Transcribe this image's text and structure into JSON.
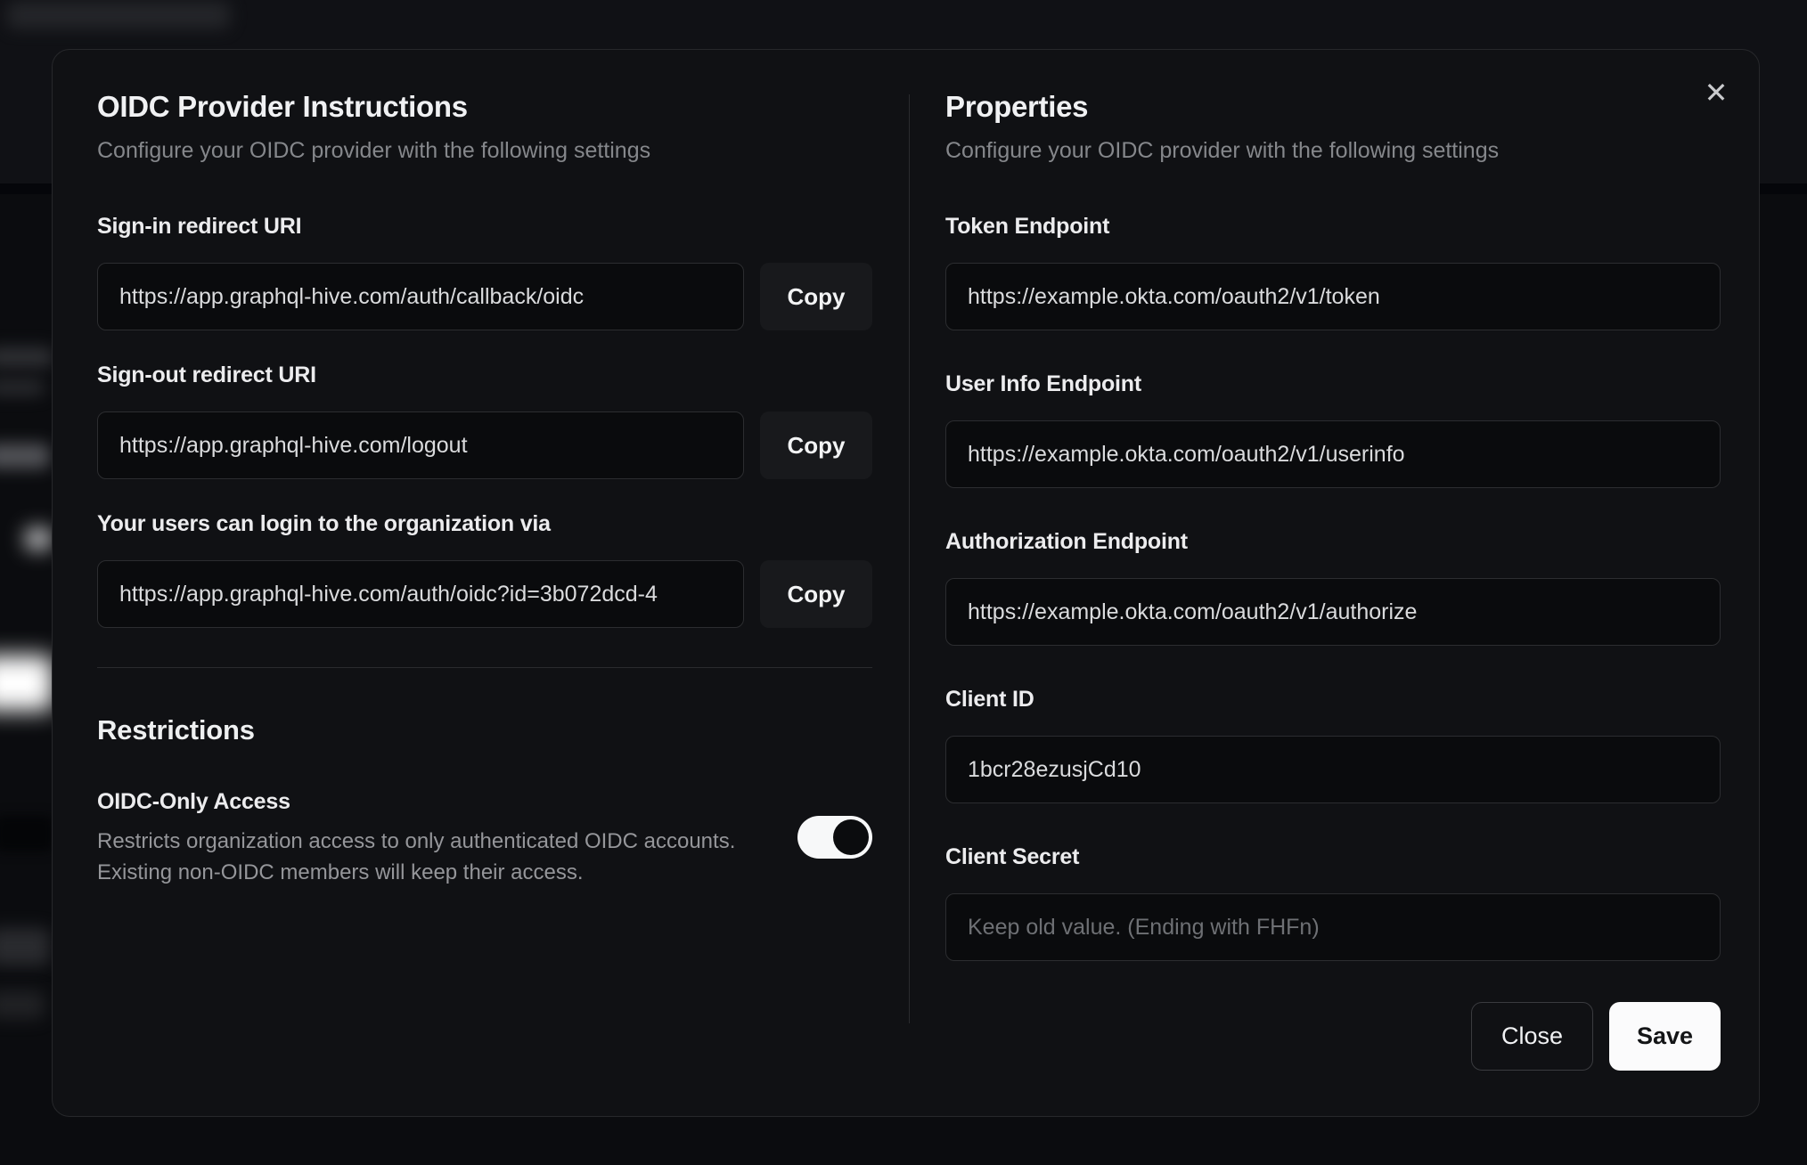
{
  "modal": {
    "close_glyph": "✕",
    "left": {
      "title": "OIDC Provider Instructions",
      "subtitle": "Configure your OIDC provider with the following settings",
      "fields": [
        {
          "label": "Sign-in redirect URI",
          "value": "https://app.graphql-hive.com/auth/callback/oidc",
          "copy_label": "Copy"
        },
        {
          "label": "Sign-out redirect URI",
          "value": "https://app.graphql-hive.com/logout",
          "copy_label": "Copy"
        },
        {
          "label": "Your users can login to the organization via",
          "value": "https://app.graphql-hive.com/auth/oidc?id=3b072dcd-4",
          "copy_label": "Copy"
        }
      ],
      "restrictions": {
        "title": "Restrictions",
        "toggle_label": "OIDC-Only Access",
        "description_line1": "Restricts organization access to only authenticated OIDC accounts.",
        "description_line2": "Existing non-OIDC members will keep their access.",
        "toggle_state": "on"
      }
    },
    "right": {
      "title": "Properties",
      "subtitle": "Configure your OIDC provider with the following settings",
      "fields": [
        {
          "label": "Token Endpoint",
          "value": "https://example.okta.com/oauth2/v1/token"
        },
        {
          "label": "User Info Endpoint",
          "value": "https://example.okta.com/oauth2/v1/userinfo"
        },
        {
          "label": "Authorization Endpoint",
          "value": "https://example.okta.com/oauth2/v1/authorize"
        },
        {
          "label": "Client ID",
          "value": "1bcr28ezusjCd10"
        },
        {
          "label": "Client Secret",
          "value": "",
          "placeholder": "Keep old value. (Ending with FHFn)"
        }
      ],
      "buttons": {
        "close": "Close",
        "save": "Save"
      }
    }
  },
  "colors": {
    "modal_background": "#101114",
    "input_background": "#0a0b0d",
    "input_border": "#2c2d30",
    "copy_button_background": "#18191c",
    "save_button_background": "#fbfbfc",
    "toggle_track": "#f7f8f9",
    "toggle_thumb": "#0b0c0e",
    "heading_text": "#f0f1f3",
    "muted_text": "#85878b"
  }
}
